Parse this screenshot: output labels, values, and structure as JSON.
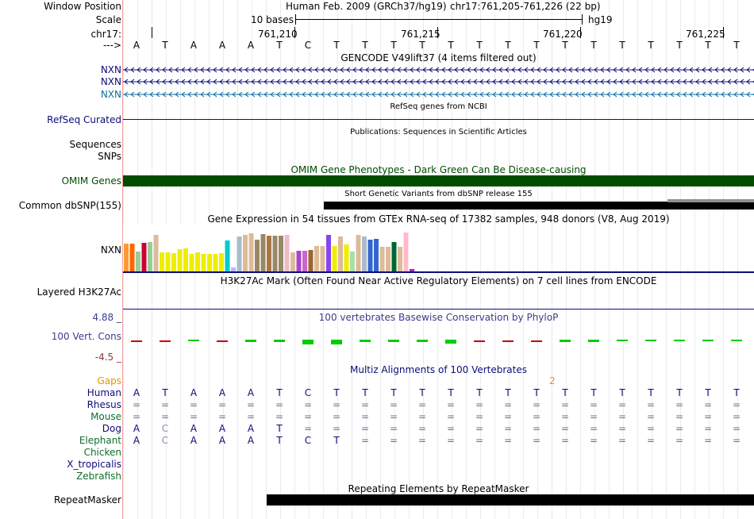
{
  "labels": {
    "window_position": "Window Position",
    "scale": "Scale",
    "chrom": "chr17:",
    "strand": "--->",
    "nxn1": "NXN",
    "nxn2": "NXN",
    "nxn3": "NXN",
    "refseq": "RefSeq Curated",
    "sequences": "Sequences",
    "snps": "SNPs",
    "omim": "OMIM Genes",
    "dbsnp": "Common dbSNP(155)",
    "gtex_gene": "NXN",
    "h3k27ac": "Layered H3K27Ac",
    "phylop_max": "4.88 _",
    "phylop_name": "100 Vert. Cons",
    "phylop_min": "-4.5 _",
    "gaps": "Gaps",
    "species": [
      "Human",
      "Rhesus",
      "Mouse",
      "Dog",
      "Elephant",
      "Chicken",
      "X_tropicalis",
      "Zebrafish"
    ],
    "repeatmasker": "RepeatMasker"
  },
  "header": {
    "assembly": "Human Feb. 2009 (GRCh37/hg19)",
    "position": "chr17:761,205-761,226 (22 bp)",
    "scale_text": "10 bases",
    "db": "hg19",
    "ticks": [
      "761,210",
      "761,215",
      "761,220",
      "761,225"
    ]
  },
  "bases": [
    "A",
    "T",
    "A",
    "A",
    "A",
    "T",
    "C",
    "T",
    "T",
    "T",
    "T",
    "T",
    "T",
    "T",
    "T",
    "T",
    "T",
    "T",
    "T",
    "T",
    "T",
    "T"
  ],
  "track_titles": {
    "gencode": "GENCODE V49lift37 (4 items filtered out)",
    "refseq": "RefSeq genes from NCBI",
    "publications": "Publications: Sequences in Scientific Articles",
    "omim": "OMIM Gene Phenotypes - Dark Green Can Be Disease-causing",
    "dbsnp": "Short Genetic Variants from dbSNP release 155",
    "gtex": "Gene Expression in 54 tissues from GTEx RNA-seq of 17382 samples, 948 donors (V8, Aug 2019)",
    "h3k27ac": "H3K27Ac Mark (Often Found Near Active Regulatory Elements) on 7 cell lines from ENCODE",
    "phylop": "100 vertebrates Basewise Conservation by PhyloP",
    "multiz": "Multiz Alignments of 100 Vertebrates",
    "repeatmasker": "Repeating Elements by RepeatMasker"
  },
  "gaps_value": "2",
  "alignment": {
    "Human": [
      "A",
      "T",
      "A",
      "A",
      "A",
      "T",
      "C",
      "T",
      "T",
      "T",
      "T",
      "T",
      "T",
      "T",
      "T",
      "T",
      "T",
      "T",
      "T",
      "T",
      "T",
      "T"
    ],
    "Rhesus": [
      "=",
      "=",
      "=",
      "=",
      "=",
      "=",
      "=",
      "=",
      "=",
      "=",
      "=",
      "=",
      "=",
      "=",
      "=",
      "=",
      "=",
      "=",
      "=",
      "=",
      "=",
      "="
    ],
    "Mouse": [
      "=",
      "=",
      "=",
      "=",
      "=",
      "=",
      "=",
      "=",
      "=",
      "=",
      "=",
      "=",
      "=",
      "=",
      "=",
      "=",
      "=",
      "=",
      "=",
      "=",
      "=",
      "="
    ],
    "Dog": [
      "A",
      "C",
      "A",
      "A",
      "A",
      "T",
      "=",
      "=",
      "=",
      "=",
      "=",
      "=",
      "=",
      "=",
      "=",
      "=",
      "=",
      "=",
      "=",
      "=",
      "=",
      "="
    ],
    "Elephant": [
      "A",
      "C",
      "A",
      "A",
      "A",
      "T",
      "C",
      "T",
      "=",
      "=",
      "=",
      "=",
      "=",
      "=",
      "=",
      "=",
      "=",
      "=",
      "=",
      "=",
      "=",
      "="
    ]
  },
  "gtex_colors": [
    "#ff9933",
    "#ff6600",
    "#99cc99",
    "#cc0033",
    "#99cc99",
    "#ddbb99",
    "#eeee00",
    "#eeee00",
    "#eeee00",
    "#eeee00",
    "#eeee00",
    "#eeee00",
    "#eeee00",
    "#eeee00",
    "#eeee00",
    "#eeee00",
    "#eeee00",
    "#00cccc",
    "#ccaaff",
    "#aabbcc",
    "#ddbb99",
    "#ddbb99",
    "#998866",
    "#998866",
    "#aa7744",
    "#998866",
    "#998866",
    "#eebbcc",
    "#ddbb99",
    "#aa44cc",
    "#cc66cc",
    "#996633",
    "#ddbb99",
    "#ddbb99",
    "#8844ee",
    "#eeee00",
    "#ddbb99",
    "#eeee00",
    "#aaddaa",
    "#ddbb99",
    "#aabbcc",
    "#3366cc",
    "#3366cc",
    "#ddbb99",
    "#ddbb99",
    "#006633",
    "#ddbb99",
    "#ffbbcc",
    "#aa22cc"
  ],
  "gtex_values": [
    0.62,
    0.62,
    0.44,
    0.64,
    0.66,
    0.82,
    0.42,
    0.42,
    0.41,
    0.5,
    0.51,
    0.4,
    0.42,
    0.4,
    0.4,
    0.4,
    0.41,
    0.7,
    0.09,
    0.78,
    0.82,
    0.86,
    0.72,
    0.84,
    0.8,
    0.8,
    0.8,
    0.82,
    0.42,
    0.46,
    0.46,
    0.48,
    0.57,
    0.58,
    0.82,
    0.58,
    0.79,
    0.6,
    0.44,
    0.82,
    0.78,
    0.72,
    0.74,
    0.55,
    0.55,
    0.66,
    0.55,
    0.88,
    0.06
  ],
  "phylop_values": [
    -0.05,
    -0.05,
    0.05,
    -0.05,
    0.45,
    0.55,
    0.95,
    0.95,
    0.55,
    0.55,
    0.55,
    0.75,
    -0.3,
    -0.25,
    -0.25,
    0.5,
    0.55,
    0.4,
    0.35,
    0.35,
    0.35,
    0.3
  ],
  "colors": {
    "gene_blue": "#0c0c78",
    "gene_teal": "#0c6ea0",
    "omim": "#004d00",
    "refseq": "#0c0c78",
    "phylop_pos": "#00cc00",
    "phylop_neg": "#cc0000",
    "alignment": "#0c0c78",
    "gaps": "#e69500",
    "phylop_label": "#3c3c8c"
  }
}
